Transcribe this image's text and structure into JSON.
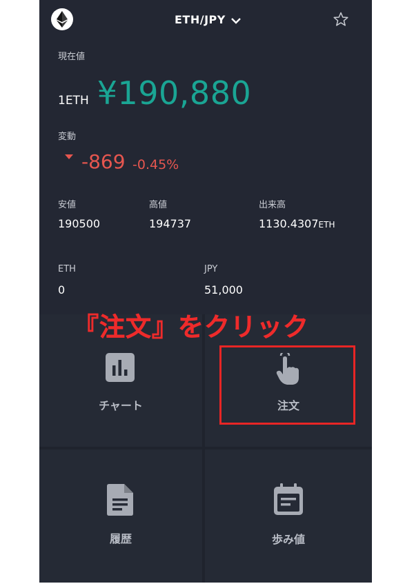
{
  "header": {
    "pair": "ETH/JPY",
    "logo_icon": "ethereum-logo-icon",
    "dropdown_icon": "chevron-down-icon",
    "favorite_icon": "star-outline-icon"
  },
  "price": {
    "label": "現在値",
    "unit": "1ETH",
    "value": "¥190,880"
  },
  "change": {
    "label": "変動",
    "direction_icon": "triangle-down-icon",
    "amount": "-869",
    "percent": "-0.45%"
  },
  "stats": {
    "low_label": "安値",
    "low_value": "190500",
    "high_label": "高値",
    "high_value": "194737",
    "volume_label": "出来高",
    "volume_value": "1130.4307",
    "volume_unit": "ETH"
  },
  "balances": {
    "eth_label": "ETH",
    "eth_value": "0",
    "jpy_label": "JPY",
    "jpy_value": "51,000"
  },
  "menu": {
    "chart_label": "チャート",
    "order_label": "注文",
    "history_label": "履歴",
    "trades_label": "歩み値"
  },
  "annotation": {
    "caption": "『注文』をクリック"
  },
  "colors": {
    "background": "#232733",
    "price_green": "#1aa594",
    "change_red": "#e6564f",
    "annotation_red": "#ee2b2b"
  }
}
